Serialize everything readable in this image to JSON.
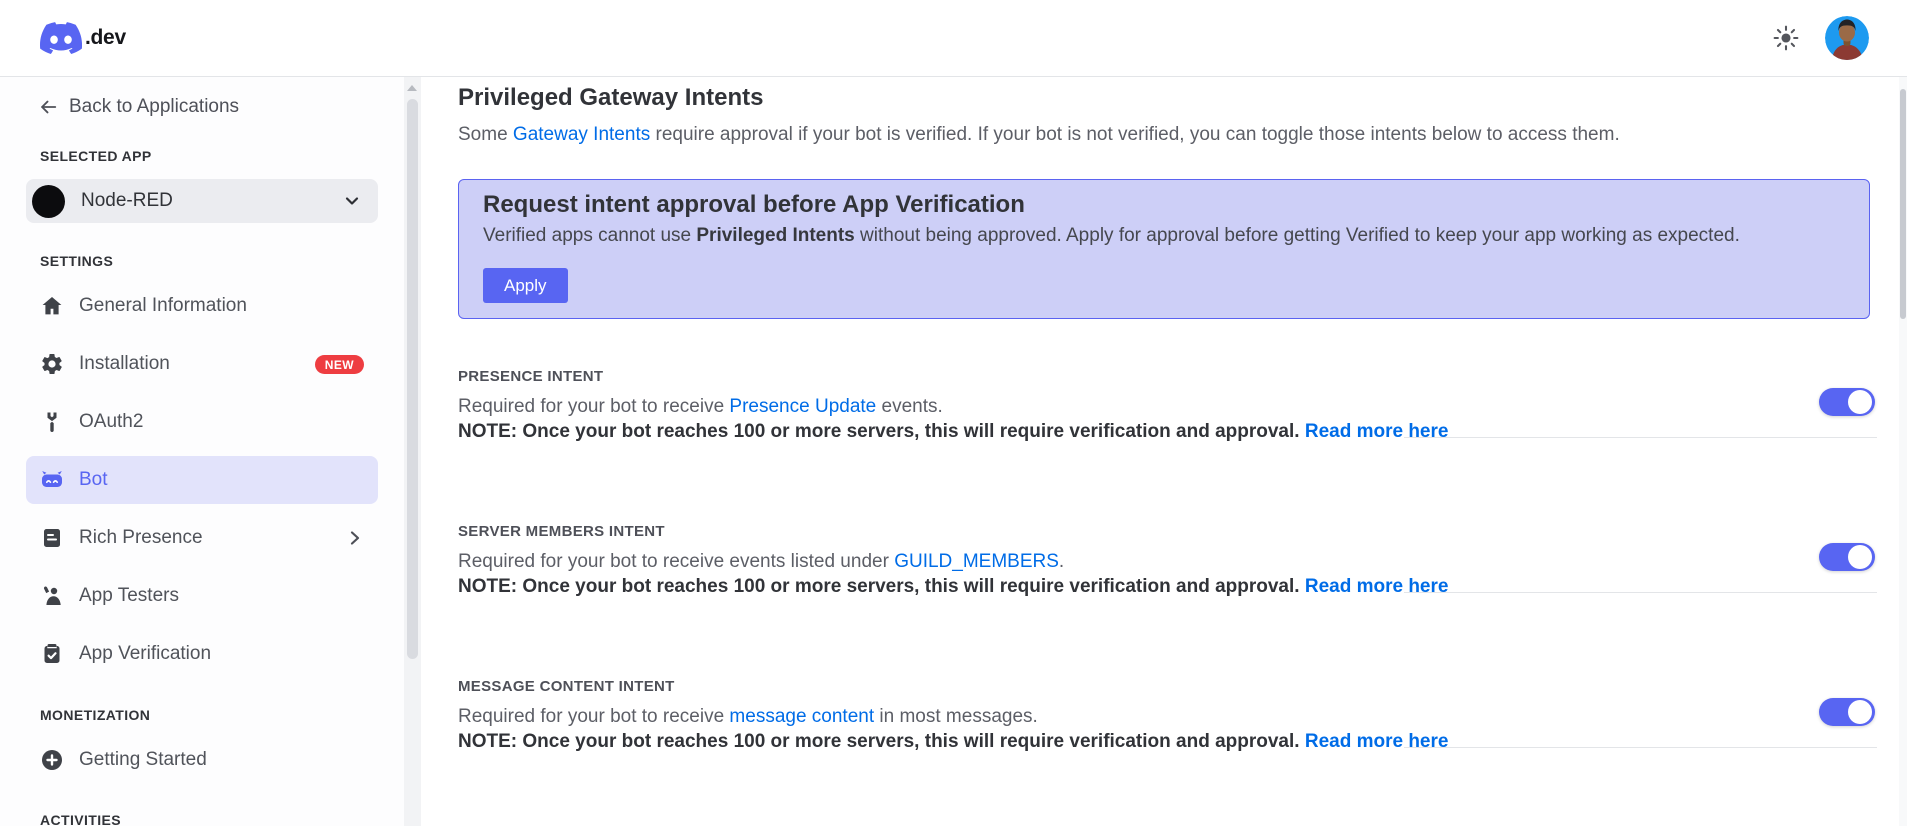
{
  "colors": {
    "blurple": "#5865F2",
    "link_blue": "#006ce7",
    "callout_bg": "#cdcff7",
    "callout_border": "#5b63f1",
    "badge_red": "#ee3d41",
    "selected_item_bg": "#e2e3fb",
    "toggle_on": "#5865F2"
  },
  "header": {
    "logo_text": ".dev",
    "theme_icon": "sun-icon",
    "avatar": "user-profile-photo"
  },
  "sidebar": {
    "back_label": "Back to Applications",
    "selected_app_heading": "SELECTED APP",
    "app_name": "Node-RED",
    "settings_heading": "SETTINGS",
    "monetization_heading": "MONETIZATION",
    "activities_heading": "ACTIVITIES",
    "items": {
      "general_information": "General Information",
      "installation": "Installation",
      "installation_badge": "NEW",
      "oauth2": "OAuth2",
      "bot": "Bot",
      "rich_presence": "Rich Presence",
      "app_testers": "App Testers",
      "app_verification": "App Verification",
      "getting_started": "Getting Started"
    }
  },
  "main": {
    "heading": "Privileged Gateway Intents",
    "intro": {
      "prefix": "Some ",
      "link": "Gateway Intents",
      "suffix": " require approval if your bot is verified. If your bot is not verified, you can toggle those intents below to access them."
    },
    "callout": {
      "title": "Request intent approval before App Verification",
      "body_prefix": "Verified apps cannot use ",
      "body_bold": "Privileged Intents",
      "body_suffix": " without being approved. Apply for approval before getting Verified to keep your app working as expected.",
      "apply_label": "Apply"
    },
    "intents": [
      {
        "label": "PRESENCE INTENT",
        "desc_prefix": "Required for your bot to receive ",
        "desc_link": "Presence Update",
        "desc_suffix": " events.",
        "note_text": "NOTE: Once your bot reaches 100 or more servers, this will require verification and approval. ",
        "note_link": "Read more here",
        "toggle_state": "on"
      },
      {
        "label": "SERVER MEMBERS INTENT",
        "desc_prefix": "Required for your bot to receive events listed under ",
        "desc_link": "GUILD_MEMBERS",
        "desc_suffix": ".",
        "note_text": "NOTE: Once your bot reaches 100 or more servers, this will require verification and approval. ",
        "note_link": "Read more here",
        "toggle_state": "on"
      },
      {
        "label": "MESSAGE CONTENT INTENT",
        "desc_prefix": "Required for your bot to receive ",
        "desc_link": "message content",
        "desc_suffix": " in most messages.",
        "note_text": "NOTE: Once your bot reaches 100 or more servers, this will require verification and approval. ",
        "note_link": "Read more here",
        "toggle_state": "on"
      }
    ]
  }
}
